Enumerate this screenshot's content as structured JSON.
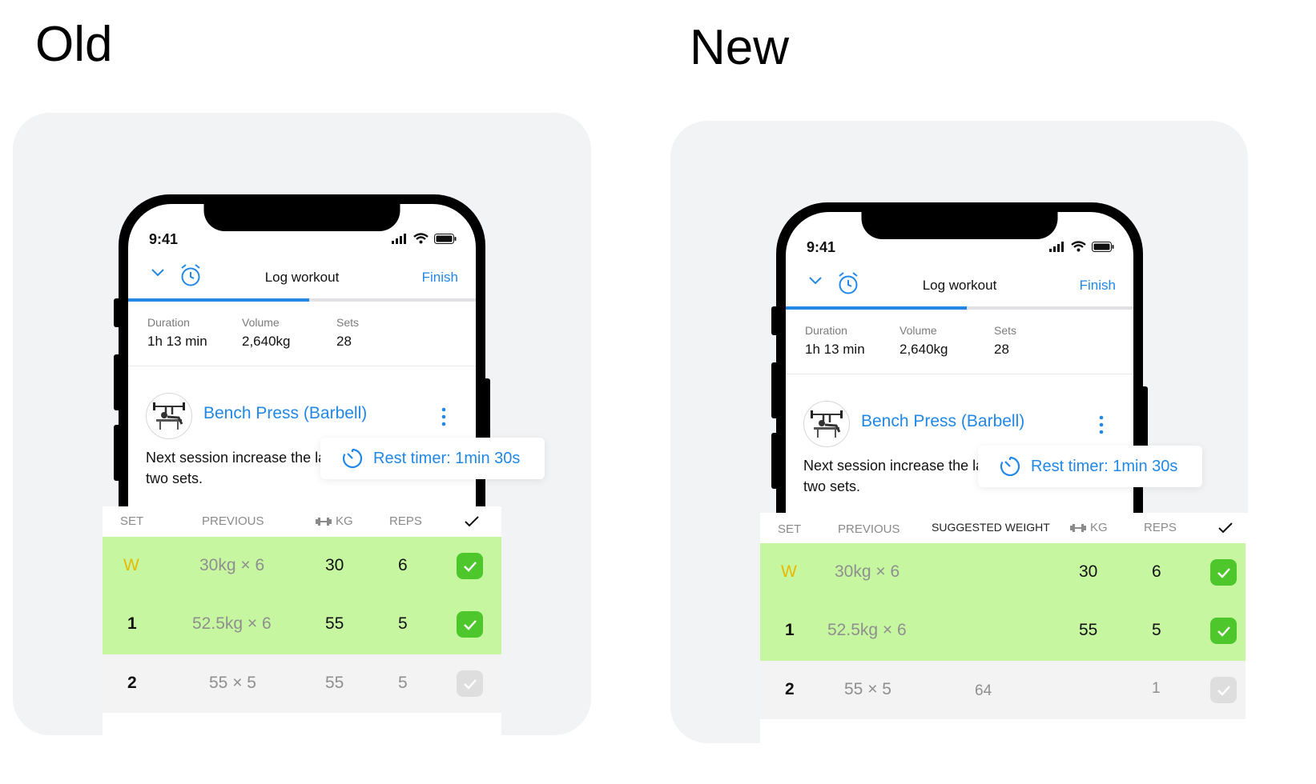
{
  "left": {
    "title": "Old",
    "phone": {
      "time": "9:41",
      "nav": {
        "title": "Log workout",
        "finish": "Finish",
        "progress": 0.52
      },
      "stats": [
        {
          "label": "Duration",
          "value": "1h 13 min"
        },
        {
          "label": "Volume",
          "value": "2,640kg"
        },
        {
          "label": "Sets",
          "value": "28"
        }
      ],
      "exercise_name": "Bench Press (Barbell)",
      "note": "Next session increase the last two sets."
    },
    "toast": "Rest timer: 1min 30s",
    "table": {
      "headers": {
        "set": "SET",
        "previous": "PREVIOUS",
        "kg": "KG",
        "reps": "REPS"
      },
      "rows": [
        {
          "set": "W",
          "previous": "30kg × 6",
          "kg": "30",
          "reps": "6",
          "done": true
        },
        {
          "set": "1",
          "previous": "52.5kg × 6",
          "kg": "55",
          "reps": "5",
          "done": true
        },
        {
          "set": "2",
          "previous": "55 × 5",
          "kg": "55",
          "reps": "5",
          "done": false
        }
      ]
    }
  },
  "right": {
    "title": "New",
    "phone": {
      "time": "9:41",
      "nav": {
        "title": "Log workout",
        "finish": "Finish",
        "progress": 0.52
      },
      "stats": [
        {
          "label": "Duration",
          "value": "1h 13 min"
        },
        {
          "label": "Volume",
          "value": "2,640kg"
        },
        {
          "label": "Sets",
          "value": "28"
        }
      ],
      "exercise_name": "Bench Press (Barbell)",
      "note": "Next session increase the last two sets."
    },
    "toast": "Rest timer: 1min 30s",
    "table": {
      "headers": {
        "set": "SET",
        "previous": "PREVIOUS",
        "suggested": "SUGGESTED WEIGHT",
        "kg": "KG",
        "reps": "REPS"
      },
      "rows": [
        {
          "set": "W",
          "previous": "30kg × 6",
          "suggested": "",
          "kg": "30",
          "reps": "6",
          "done": true
        },
        {
          "set": "1",
          "previous": "52.5kg × 6",
          "suggested": "",
          "kg": "55",
          "reps": "5",
          "done": true
        },
        {
          "set": "2",
          "previous": "55 × 5",
          "suggested": "64",
          "kg": "",
          "reps": "1",
          "done": false
        }
      ]
    }
  },
  "colors": {
    "accent": "#2188e8",
    "done_row": "#c6f7a0",
    "check_on": "#4ec72d",
    "warmup": "#e8b900"
  }
}
